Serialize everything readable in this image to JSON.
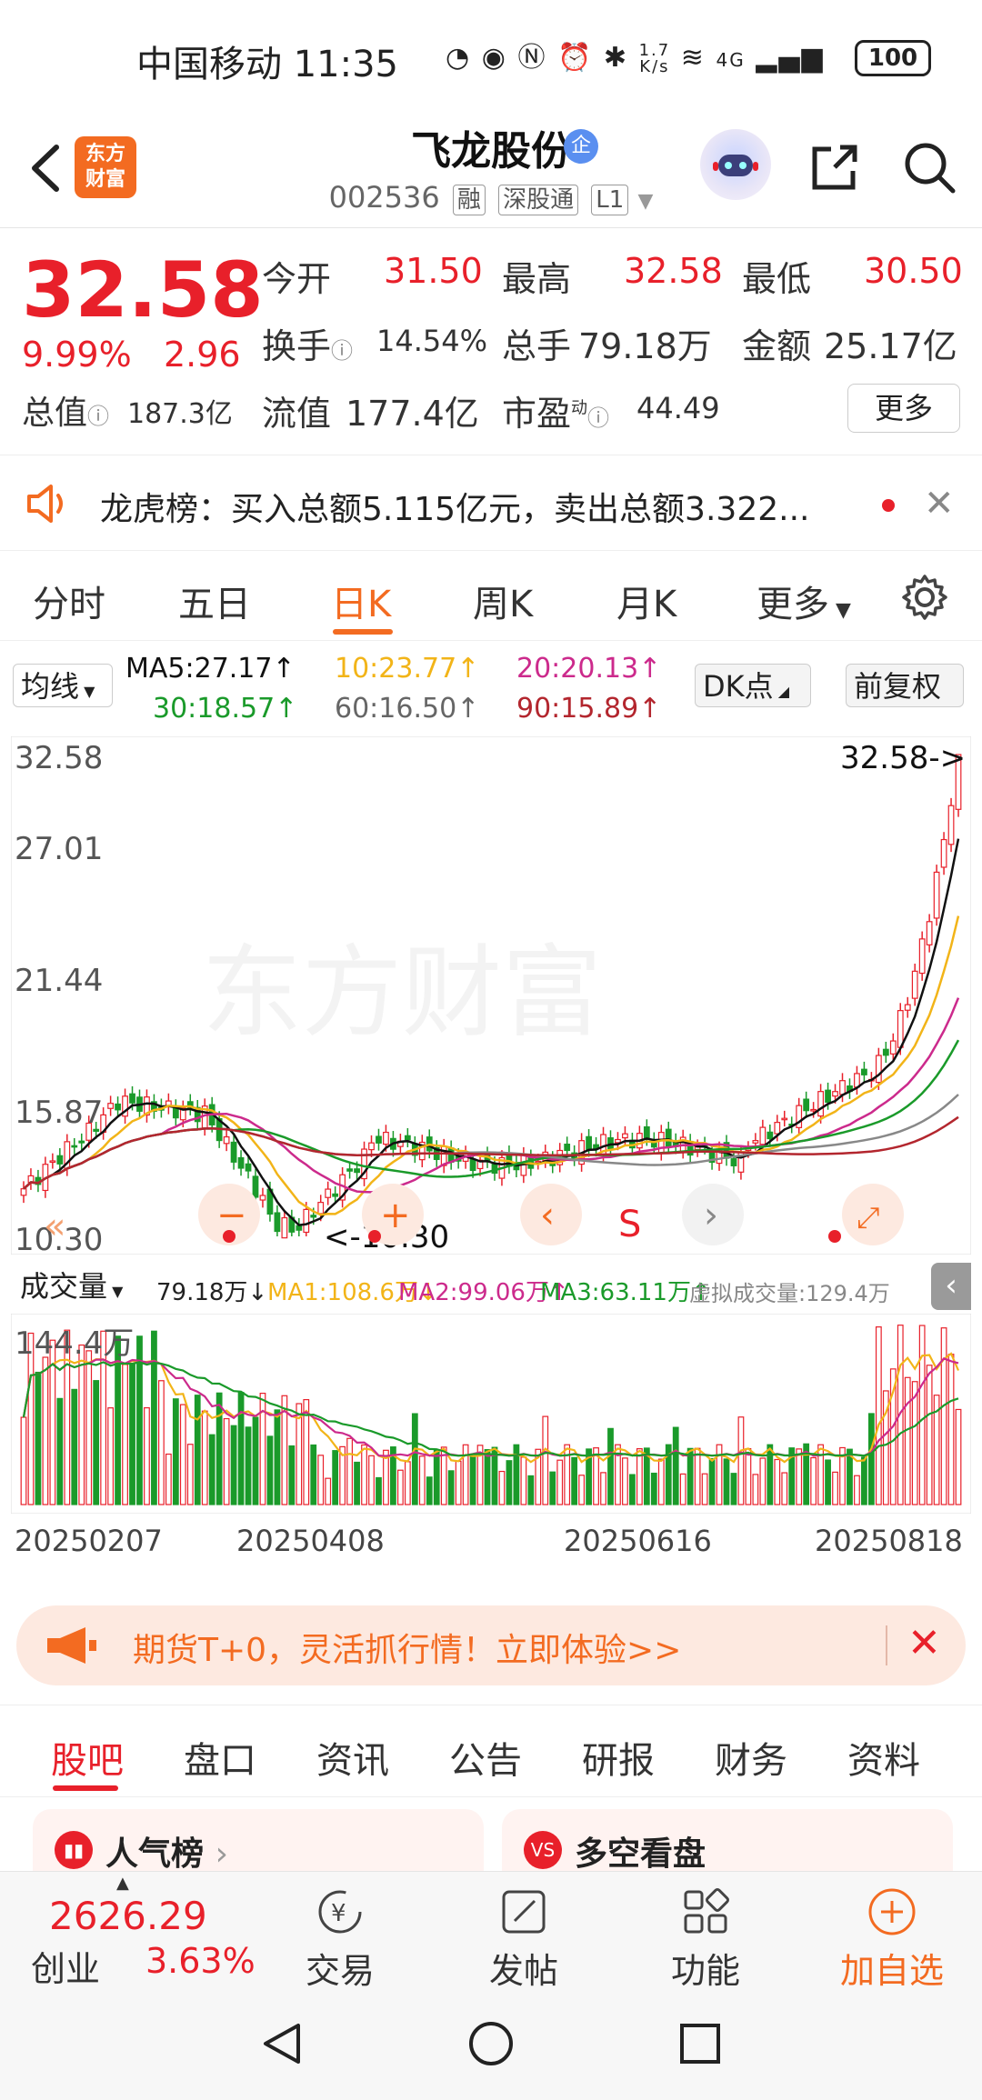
{
  "status_bar": {
    "carrier_time": "中国移动 11:35",
    "net_speed_top": "1.7",
    "net_speed_bottom": "K/s",
    "network": "4G",
    "battery": "100"
  },
  "header": {
    "logo_text_1": "东方",
    "logo_text_2": "财富",
    "title": "飞龙股份",
    "ent_badge": "企",
    "code": "002536",
    "tags": [
      "融",
      "深股通",
      "L1"
    ]
  },
  "quote": {
    "last_price": "32.58",
    "pct_change": "9.99%",
    "abs_change": "2.96",
    "open_label": "今开",
    "open_value": "31.50",
    "high_label": "最高",
    "high_value": "32.58",
    "low_label": "最低",
    "low_value": "30.50",
    "turnover_label": "换手",
    "turnover_value": "14.54%",
    "volume_label": "总手",
    "volume_value": "79.18万",
    "amount_label": "金额",
    "amount_value": "25.17亿",
    "mktcap_label": "总值",
    "mktcap_value": "187.3亿",
    "float_label": "流值",
    "float_value": "177.4亿",
    "pe_label": "市盈",
    "pe_sup": "动",
    "pe_value": "44.49",
    "more_label": "更多"
  },
  "notice": {
    "text": "龙虎榜：买入总额5.115亿元，卖出总额3.322..."
  },
  "period_tabs": {
    "items": [
      "分时",
      "五日",
      "日K",
      "周K",
      "月K",
      "更多"
    ],
    "active": "日K"
  },
  "ma_row": {
    "type_select": "均线",
    "ma5": "MA5:27.17",
    "ma10": "10:23.77",
    "ma20": "20:20.13",
    "ma30": "30:18.57",
    "ma60": "60:16.50",
    "ma90": "90:15.89",
    "dk_select": "DK点",
    "adjust_select": "前复权"
  },
  "chart_labels": {
    "y_max": "32.58",
    "y_2": "27.01",
    "y_3": "21.44",
    "y_4": "15.87",
    "y_min": "10.30",
    "last_marker": "32.58->",
    "low_marker": "<-10.30",
    "watermark": "东方财富",
    "s_marker": "S"
  },
  "volume_header": {
    "select": "成交量",
    "value": "79.18万",
    "ma1": "MA1:108.6万",
    "ma2": "MA2:99.06万",
    "ma3": "MA3:63.11万",
    "virtual": "虚拟成交量:129.4万",
    "y_max": "144.4万"
  },
  "dates": [
    "20250207",
    "20250408",
    "20250616",
    "20250818"
  ],
  "promo": {
    "text": "期货T+0，灵活抓行情！立即体验>>"
  },
  "section_tabs": {
    "items": [
      "股吧",
      "盘口",
      "资讯",
      "公告",
      "研报",
      "财务",
      "资料"
    ],
    "active": "股吧"
  },
  "cards": [
    {
      "title": "人气榜",
      "icon": "chart"
    },
    {
      "title": "多空看盘",
      "icon": "VS"
    }
  ],
  "bottom_bar": {
    "index_value": "2626.29",
    "index_name": "创业",
    "index_pct": "3.63%",
    "nav": [
      {
        "label": "交易",
        "icon": "trade-icon"
      },
      {
        "label": "发帖",
        "icon": "post-icon"
      },
      {
        "label": "功能",
        "icon": "grid-icon"
      },
      {
        "label": "加自选",
        "icon": "add-watchlist-icon"
      }
    ]
  },
  "chart_data": {
    "type": "candlestick",
    "y_range": [
      10.3,
      32.58
    ],
    "y_ticks": [
      32.58,
      27.01,
      21.44,
      15.87,
      10.3
    ],
    "x_ticks": [
      "20250207",
      "20250408",
      "20250616",
      "20250818"
    ],
    "last": 32.58,
    "low": 10.3,
    "ma": {
      "MA5": 27.17,
      "MA10": 23.77,
      "MA20": 20.13,
      "MA30": 18.57,
      "MA60": 16.5,
      "MA90": 15.89
    },
    "volume": {
      "current": "79.18万",
      "MA1": "108.6万",
      "MA2": "99.06万",
      "MA3": "63.11万",
      "max": "144.4万"
    },
    "colors": {
      "up": "#e8202a",
      "down": "#1a9a2a",
      "ma5": "#111111",
      "ma10": "#f2b418",
      "ma20": "#cc2a8c",
      "ma30": "#1a9a2a",
      "ma60": "#888888",
      "ma90": "#b3262e"
    }
  }
}
